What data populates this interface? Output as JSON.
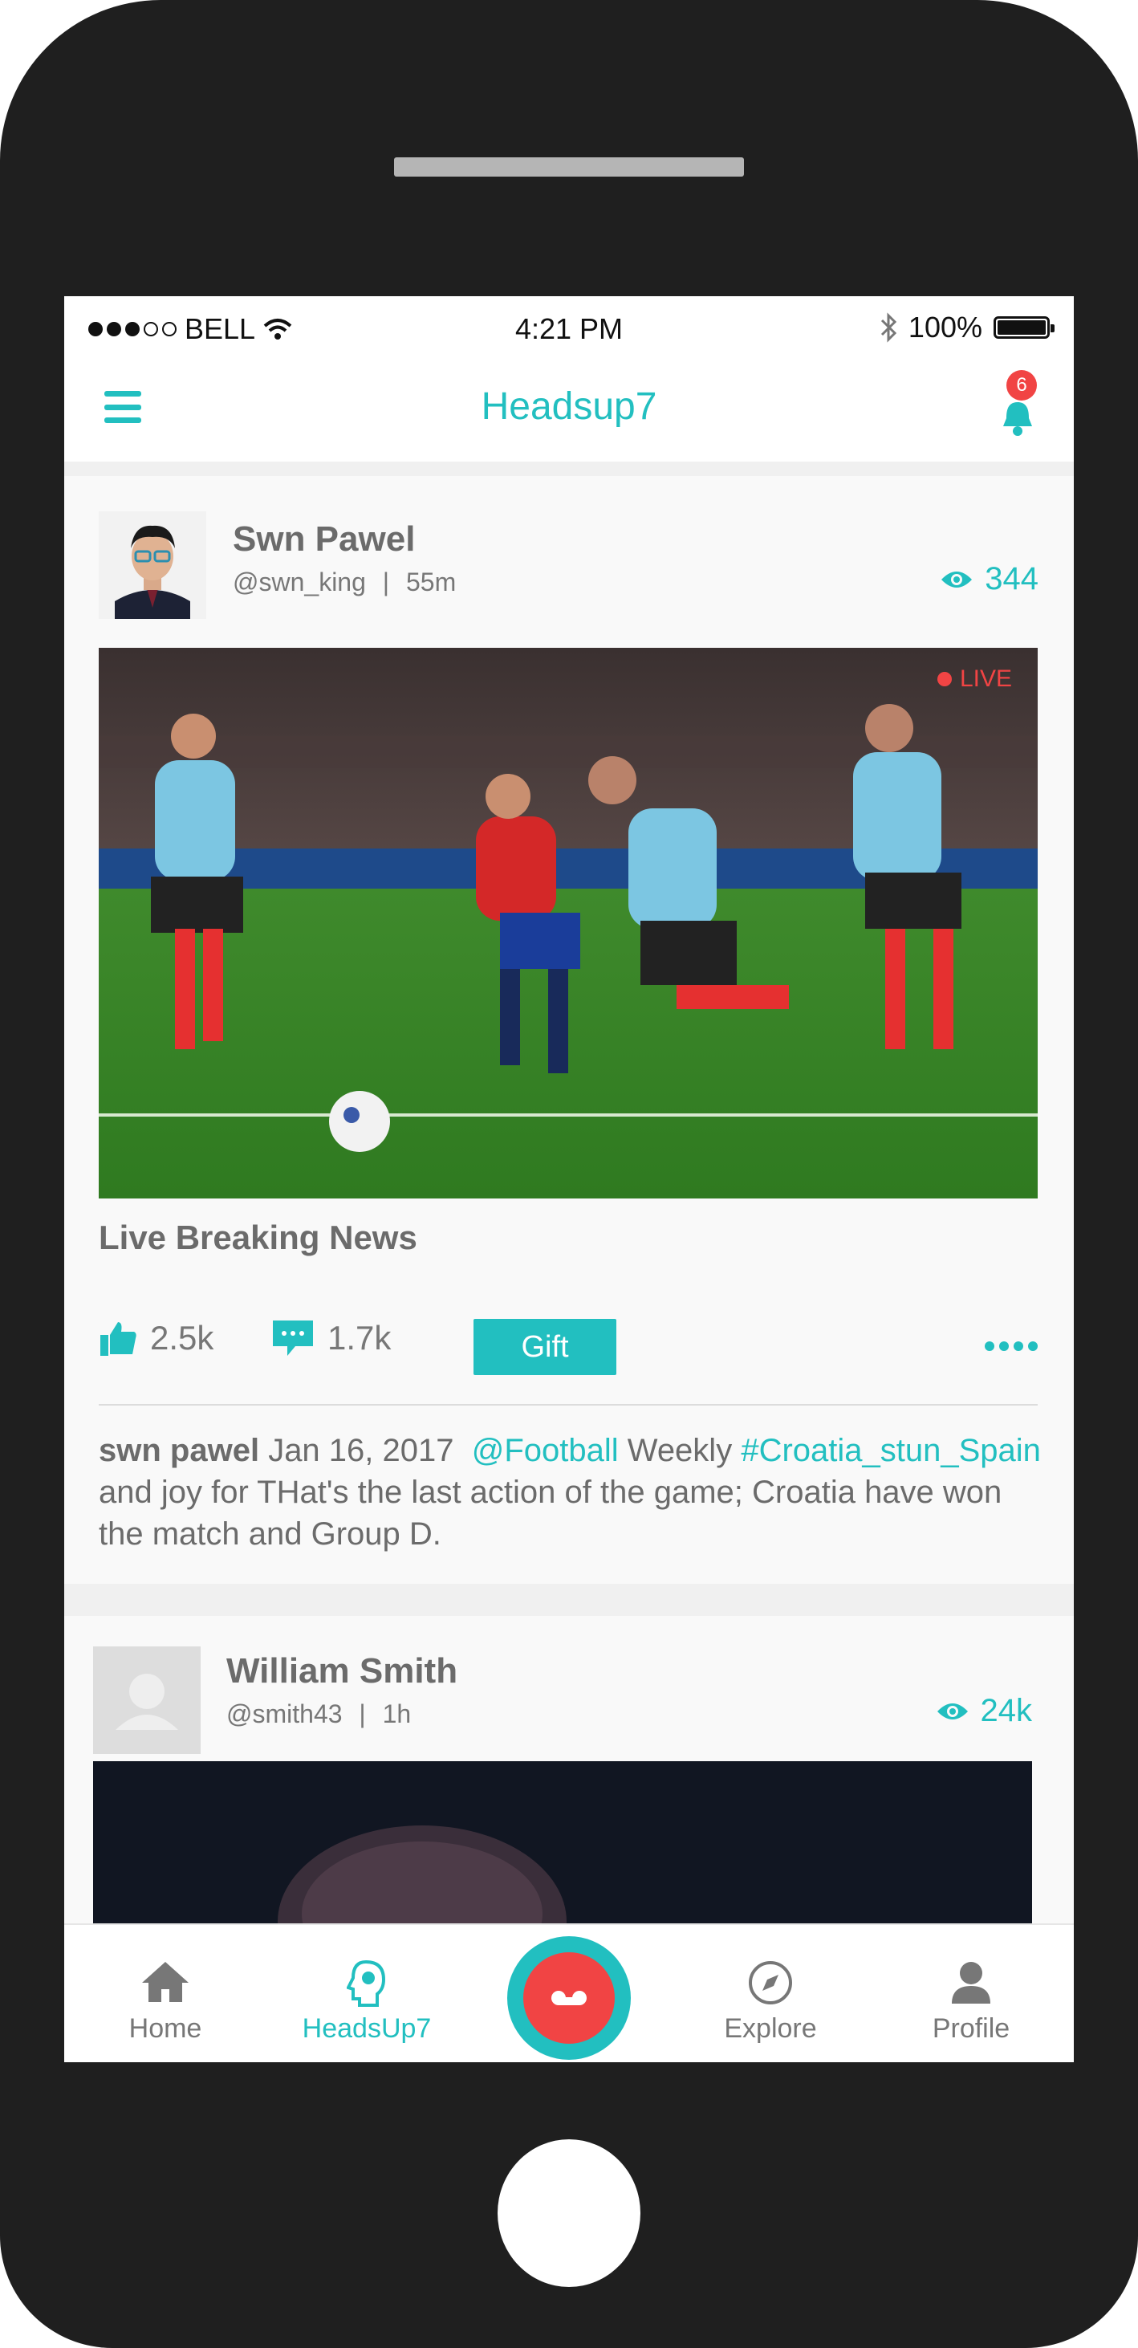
{
  "status_bar": {
    "carrier": "BELL",
    "time": "4:21 PM",
    "battery": "100%"
  },
  "nav": {
    "title": "Headsup7",
    "notification_count": "6"
  },
  "posts": [
    {
      "name": "Swn Pawel",
      "handle": "@swn_king",
      "separator": "|",
      "age": "55m",
      "views": "344",
      "live_label": "LIVE",
      "title": "Live Breaking News",
      "likes": "2.5k",
      "comments": "1.7k",
      "gift_label": "Gift",
      "description": {
        "author": "swn pawel",
        "date": "Jan 16, 2017",
        "mention": "@Football",
        "word": "Weekly",
        "hashtag": "#Croatia_stun_Spain",
        "text": "and joy for THat's the last action of the game; Croatia have won the match and Group D."
      }
    },
    {
      "name": "William Smith",
      "handle": "@smith43",
      "separator": "|",
      "age": "1h",
      "views": "24k"
    }
  ],
  "tabs": [
    {
      "label": "Home",
      "icon": "home-icon"
    },
    {
      "label": "HeadsUp7",
      "icon": "headsup7-icon"
    },
    {
      "label": "Explore",
      "icon": "compass-icon"
    },
    {
      "label": "Profile",
      "icon": "user-icon"
    }
  ],
  "colors": {
    "accent": "#22bfc0",
    "live": "#f14444",
    "record": "#f14444",
    "phone_frame": "#1f1f1f"
  }
}
